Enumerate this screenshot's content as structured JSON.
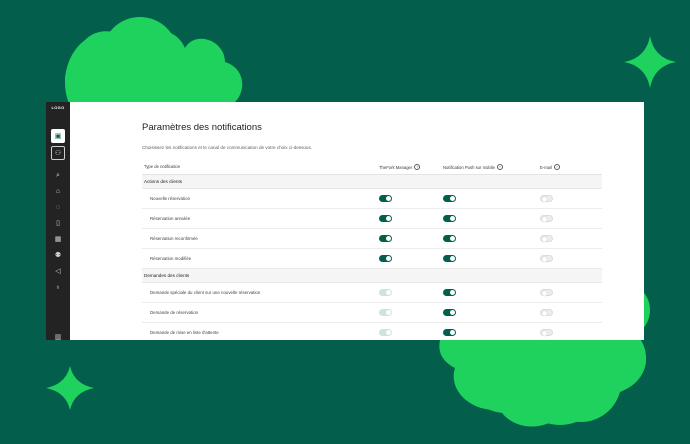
{
  "sidebar": {
    "logo": "LOGO",
    "items": [
      {
        "icon": "edit-icon",
        "glyph": "▣",
        "active": true
      },
      {
        "icon": "user-add-icon",
        "glyph": "⚇",
        "active": false
      },
      {
        "icon": "search-icon",
        "glyph": "⌕",
        "active": false
      },
      {
        "icon": "home-icon",
        "glyph": "⌂",
        "active": false
      },
      {
        "icon": "chat-icon",
        "glyph": "◌",
        "active": false
      },
      {
        "icon": "book-icon",
        "glyph": "▯",
        "active": false
      },
      {
        "icon": "calendar-icon",
        "glyph": "▦",
        "active": false
      },
      {
        "icon": "users-icon",
        "glyph": "⚉",
        "active": false
      },
      {
        "icon": "megaphone-icon",
        "glyph": "◁",
        "active": false
      },
      {
        "icon": "lightbulb-icon",
        "glyph": "♁",
        "active": false
      },
      {
        "icon": "trash-icon",
        "glyph": "▥",
        "active": false
      }
    ]
  },
  "page": {
    "title": "Paramètres des notifications",
    "subtitle": "Choisissez les notifications et le canal de communication de votre choix ci-dessous."
  },
  "columns": {
    "type": "Type de notification",
    "manager": "TheFork Manager",
    "push": "Notification Push sur mobile",
    "email": "E-mail",
    "help": "?"
  },
  "sections": [
    {
      "title": "Actions des clients",
      "rows": [
        {
          "label": "Nouvelle réservation",
          "manager": "on",
          "push": "on",
          "email": "off"
        },
        {
          "label": "Réservation annulée",
          "manager": "on",
          "push": "on",
          "email": "off"
        },
        {
          "label": "Réservation reconfirmée",
          "manager": "on",
          "push": "on",
          "email": "off"
        },
        {
          "label": "Réservation modifiée",
          "manager": "on",
          "push": "on",
          "email": "off"
        }
      ]
    },
    {
      "title": "Demandes des clients",
      "rows": [
        {
          "label": "Demande spéciale du client sur une nouvelle réservation",
          "manager": "disabled",
          "push": "on",
          "email": "off"
        },
        {
          "label": "Demande de réservation",
          "manager": "disabled",
          "push": "on",
          "email": "off"
        },
        {
          "label": "Demande de mise en liste d'attente",
          "manager": "disabled",
          "push": "on",
          "email": "off"
        }
      ]
    }
  ],
  "colors": {
    "background": "#035f4b",
    "shape": "#1fd25e",
    "toggle_on": "#035f4b"
  }
}
